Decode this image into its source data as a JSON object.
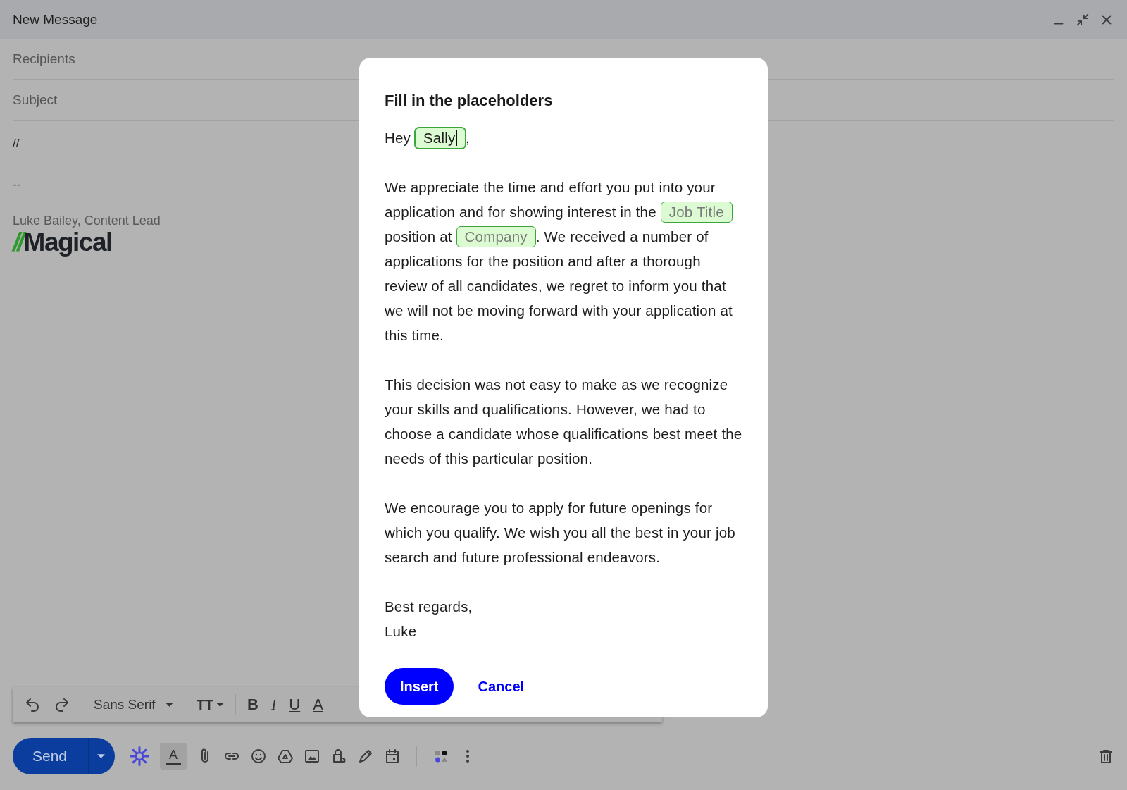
{
  "window": {
    "title": "New Message"
  },
  "compose": {
    "recipients": {
      "placeholder": "Recipients"
    },
    "subject": {
      "placeholder": "Subject"
    },
    "body_lines": [
      "//",
      "--"
    ],
    "signature": "Luke Bailey, Content Lead",
    "logo": {
      "mark": "//",
      "name": "Magical"
    }
  },
  "format_toolbar": {
    "font": "Sans Serif",
    "size_glyph": "TT",
    "style_glyphs": [
      "B",
      "I",
      "U",
      "A"
    ]
  },
  "bottom_bar": {
    "send": "Send",
    "text_color": {
      "glyph": "A",
      "selected": true
    }
  },
  "dialog": {
    "title": "Fill in the placeholders",
    "paragraphs": [
      [
        {
          "kind": "text",
          "text": "Hey "
        },
        {
          "kind": "field",
          "value": "Sally",
          "focused": true
        },
        {
          "kind": "text",
          "text": ","
        }
      ],
      [
        {
          "kind": "text",
          "text": "We appreciate the time and effort you put into your application and for showing interest in the "
        },
        {
          "kind": "field",
          "placeholder": "Job Title",
          "focused": false
        },
        {
          "kind": "text",
          "text": " position at "
        },
        {
          "kind": "field",
          "placeholder": "Company",
          "focused": false
        },
        {
          "kind": "text",
          "text": ". We received a number of applications for the position and after a thorough review of all candidates, we regret to inform you that we will not be moving forward with your application at this time."
        }
      ],
      [
        {
          "kind": "text",
          "text": "This decision was not easy to make as we recognize your skills and qualifications. However, we had to choose a candidate whose qualifications best meet the needs of this particular position."
        }
      ],
      [
        {
          "kind": "text",
          "text": "We encourage you to apply for future openings for which you qualify. We wish you all the best in your job search and future professional endeavors."
        }
      ],
      [
        {
          "kind": "text",
          "text": "Best regards,"
        }
      ],
      [
        {
          "kind": "text",
          "text": "Luke"
        }
      ]
    ],
    "primary": "Insert",
    "secondary": "Cancel"
  }
}
